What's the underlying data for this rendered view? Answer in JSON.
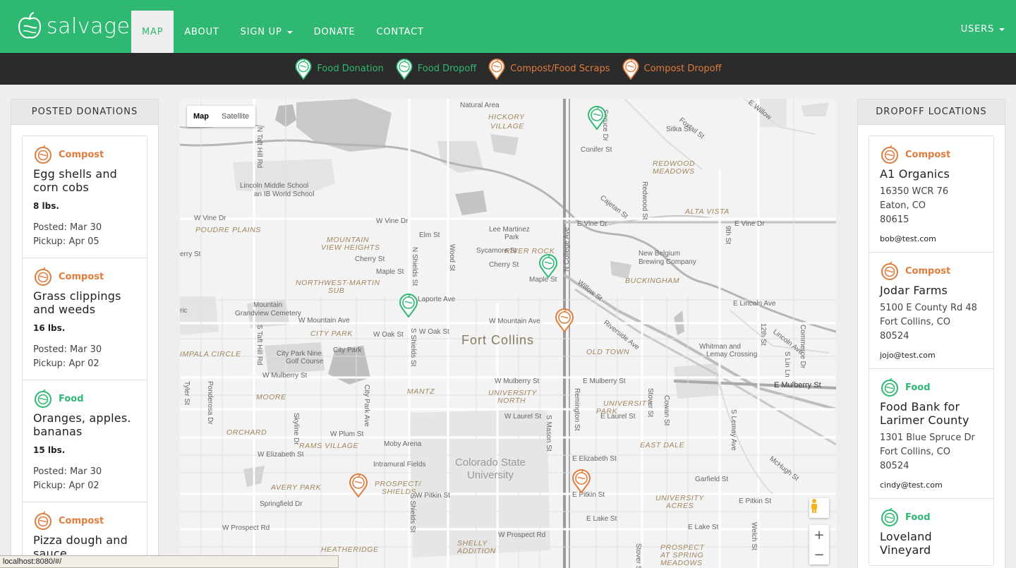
{
  "brand": {
    "name": "salvage"
  },
  "colors": {
    "green": "#2eb872",
    "orange": "#e07b3c",
    "dark": "#2b2b2b"
  },
  "nav": {
    "items": [
      {
        "label": "MAP",
        "active": true
      },
      {
        "label": "ABOUT"
      },
      {
        "label": "SIGN UP",
        "dropdown": true
      },
      {
        "label": "DONATE"
      },
      {
        "label": "CONTACT"
      }
    ],
    "users": "USERS"
  },
  "legend": [
    {
      "label": "Food Donation",
      "color": "green"
    },
    {
      "label": "Food Dropoff",
      "color": "green"
    },
    {
      "label": "Compost/Food Scraps",
      "color": "orange"
    },
    {
      "label": "Compost Dropoff",
      "color": "orange"
    }
  ],
  "posted_donations": {
    "heading": "POSTED DONATIONS",
    "items": [
      {
        "type": "Compost",
        "title": "Egg shells and corn cobs",
        "weight": "8 lbs.",
        "posted": "Posted: Mar 30",
        "pickup": "Pickup: Apr 05"
      },
      {
        "type": "Compost",
        "title": "Grass clippings and weeds",
        "weight": "16 lbs.",
        "posted": "Posted: Mar 30",
        "pickup": "Pickup: Apr 02"
      },
      {
        "type": "Food",
        "title": "Oranges, apples. bananas",
        "weight": "15 lbs.",
        "posted": "Posted: Mar 30",
        "pickup": "Pickup: Apr 02"
      },
      {
        "type": "Compost",
        "title": "Pizza dough and sauce"
      }
    ]
  },
  "dropoff_locations": {
    "heading": "DROPOFF LOCATIONS",
    "items": [
      {
        "type": "Compost",
        "name": "A1 Organics",
        "address1": "16350 WCR 76",
        "address2": "Eaton, CO",
        "zip": "80615",
        "email": "bob@test.com"
      },
      {
        "type": "Compost",
        "name": "Jodar Farms",
        "address1": "5100 E County Rd 48",
        "address2": "Fort Collins, CO",
        "zip": "80524",
        "email": "jojo@test.com"
      },
      {
        "type": "Food",
        "name": "Food Bank for Larimer County",
        "address1": "1301 Blue Spruce Dr",
        "address2": "Fort Collins, CO",
        "zip": "80524",
        "email": "cindy@test.com"
      },
      {
        "type": "Food",
        "name": "Loveland Vineyard"
      }
    ]
  },
  "map": {
    "type_buttons": [
      "Map",
      "Satellite"
    ],
    "city": "Fort Collins",
    "university": "Colorado State University",
    "zoom_in": "+",
    "zoom_out": "−"
  },
  "statusbar": "localhost:8080/#/"
}
